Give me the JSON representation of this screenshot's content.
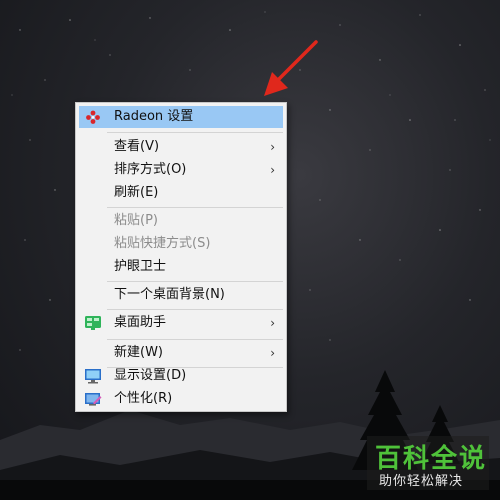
{
  "context_menu": {
    "items": [
      {
        "label": "Radeon 设置",
        "icon": "radeon-icon",
        "highlighted": true
      },
      {
        "label": "查看(V)",
        "has_submenu": true
      },
      {
        "label": "排序方式(O)",
        "has_submenu": true
      },
      {
        "label": "刷新(E)"
      },
      {
        "label": "粘贴(P)",
        "disabled": true
      },
      {
        "label": "粘贴快捷方式(S)",
        "disabled": true
      },
      {
        "label": "护眼卫士"
      },
      {
        "label": "下一个桌面背景(N)"
      },
      {
        "label": "桌面助手",
        "icon": "desktop-assistant-icon",
        "has_submenu": true
      },
      {
        "label": "新建(W)",
        "has_submenu": true
      },
      {
        "label": "显示设置(D)",
        "icon": "display-settings-icon"
      },
      {
        "label": "个性化(R)",
        "icon": "personalize-icon"
      }
    ],
    "submenu_glyph": "›"
  },
  "watermark": {
    "title": "百科全说",
    "subtitle": "助你轻松解决"
  },
  "colors": {
    "highlight": "#99c8f4",
    "menu_bg": "#f2f2f2",
    "arrow": "#e0281c",
    "watermark_green": "#4fc23a"
  }
}
